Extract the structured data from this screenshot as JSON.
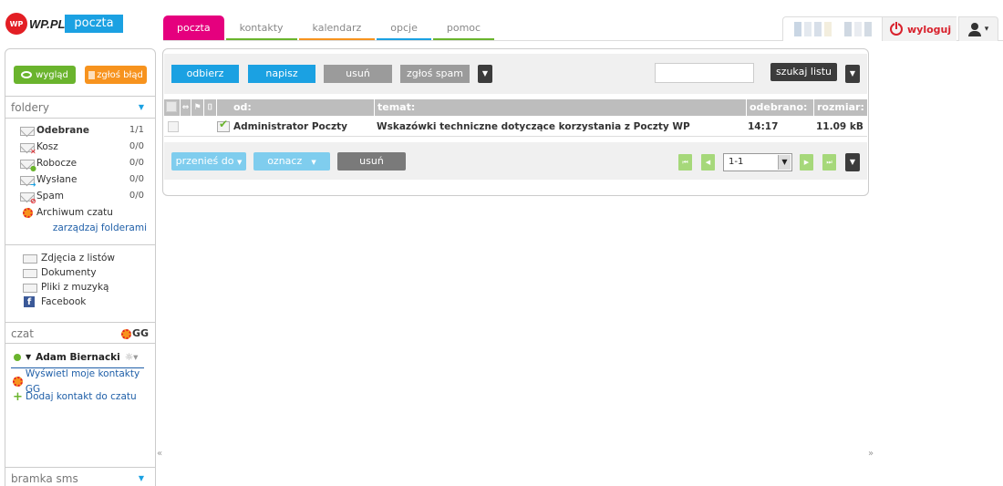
{
  "brand": {
    "logo_mark": "WP",
    "logo_text": "WP.PL",
    "app_name": "poczta"
  },
  "tabs": [
    {
      "label": "poczta",
      "color": "#e5007e",
      "active": true
    },
    {
      "label": "kontakty",
      "color": "#6ab42d"
    },
    {
      "label": "kalendarz",
      "color": "#f7931e"
    },
    {
      "label": "opcje",
      "color": "#1ba1e2"
    },
    {
      "label": "pomoc",
      "color": "#6ab42d"
    }
  ],
  "userbar": {
    "logout_label": "wyloguj",
    "user_icon": "user-icon",
    "caret": "▾"
  },
  "sidebar": {
    "look_label": "wygląd",
    "report_label": "zgłoś błąd",
    "folders_title": "foldery",
    "folders": [
      {
        "label": "Odebrane",
        "count": "1/1",
        "bold": true
      },
      {
        "label": "Kosz",
        "count": "0/0"
      },
      {
        "label": "Robocze",
        "count": "0/0"
      },
      {
        "label": "Wysłane",
        "count": "0/0"
      },
      {
        "label": "Spam",
        "count": "0/0"
      }
    ],
    "chat_archive": "Archiwum czatu",
    "manage_folders": "zarządzaj folderami",
    "attachments": [
      {
        "label": "Zdjęcia z listów"
      },
      {
        "label": "Dokumenty"
      },
      {
        "label": "Pliki z muzyką"
      },
      {
        "label": "Facebook"
      }
    ],
    "chat_title": "czat",
    "gg_label": "GG",
    "user_name": "Adam Biernacki",
    "show_gg_contacts": "Wyświetl moje kontakty GG",
    "add_chat_contact": "Dodaj kontakt do czatu",
    "sms_title": "bramka sms"
  },
  "toolbar": {
    "receive": "odbierz",
    "compose": "napisz",
    "delete": "usuń",
    "report_spam": "zgłoś spam",
    "search_value": "",
    "search_button": "szukaj listu"
  },
  "table": {
    "columns": {
      "from": "od:",
      "subject": "temat:",
      "received": "odebrano:",
      "size": "rozmiar:"
    },
    "rows": [
      {
        "from": "Administrator Poczty",
        "subject": "Wskazówki techniczne dotyczące korzystania z Poczty WP",
        "received": "14:17",
        "size": "11.09 kB"
      }
    ]
  },
  "bottom": {
    "move_to": "przenieś do",
    "mark": "oznacz",
    "delete": "usuń",
    "page_value": "1-1"
  },
  "nav": {
    "left": "«",
    "right": "»"
  }
}
